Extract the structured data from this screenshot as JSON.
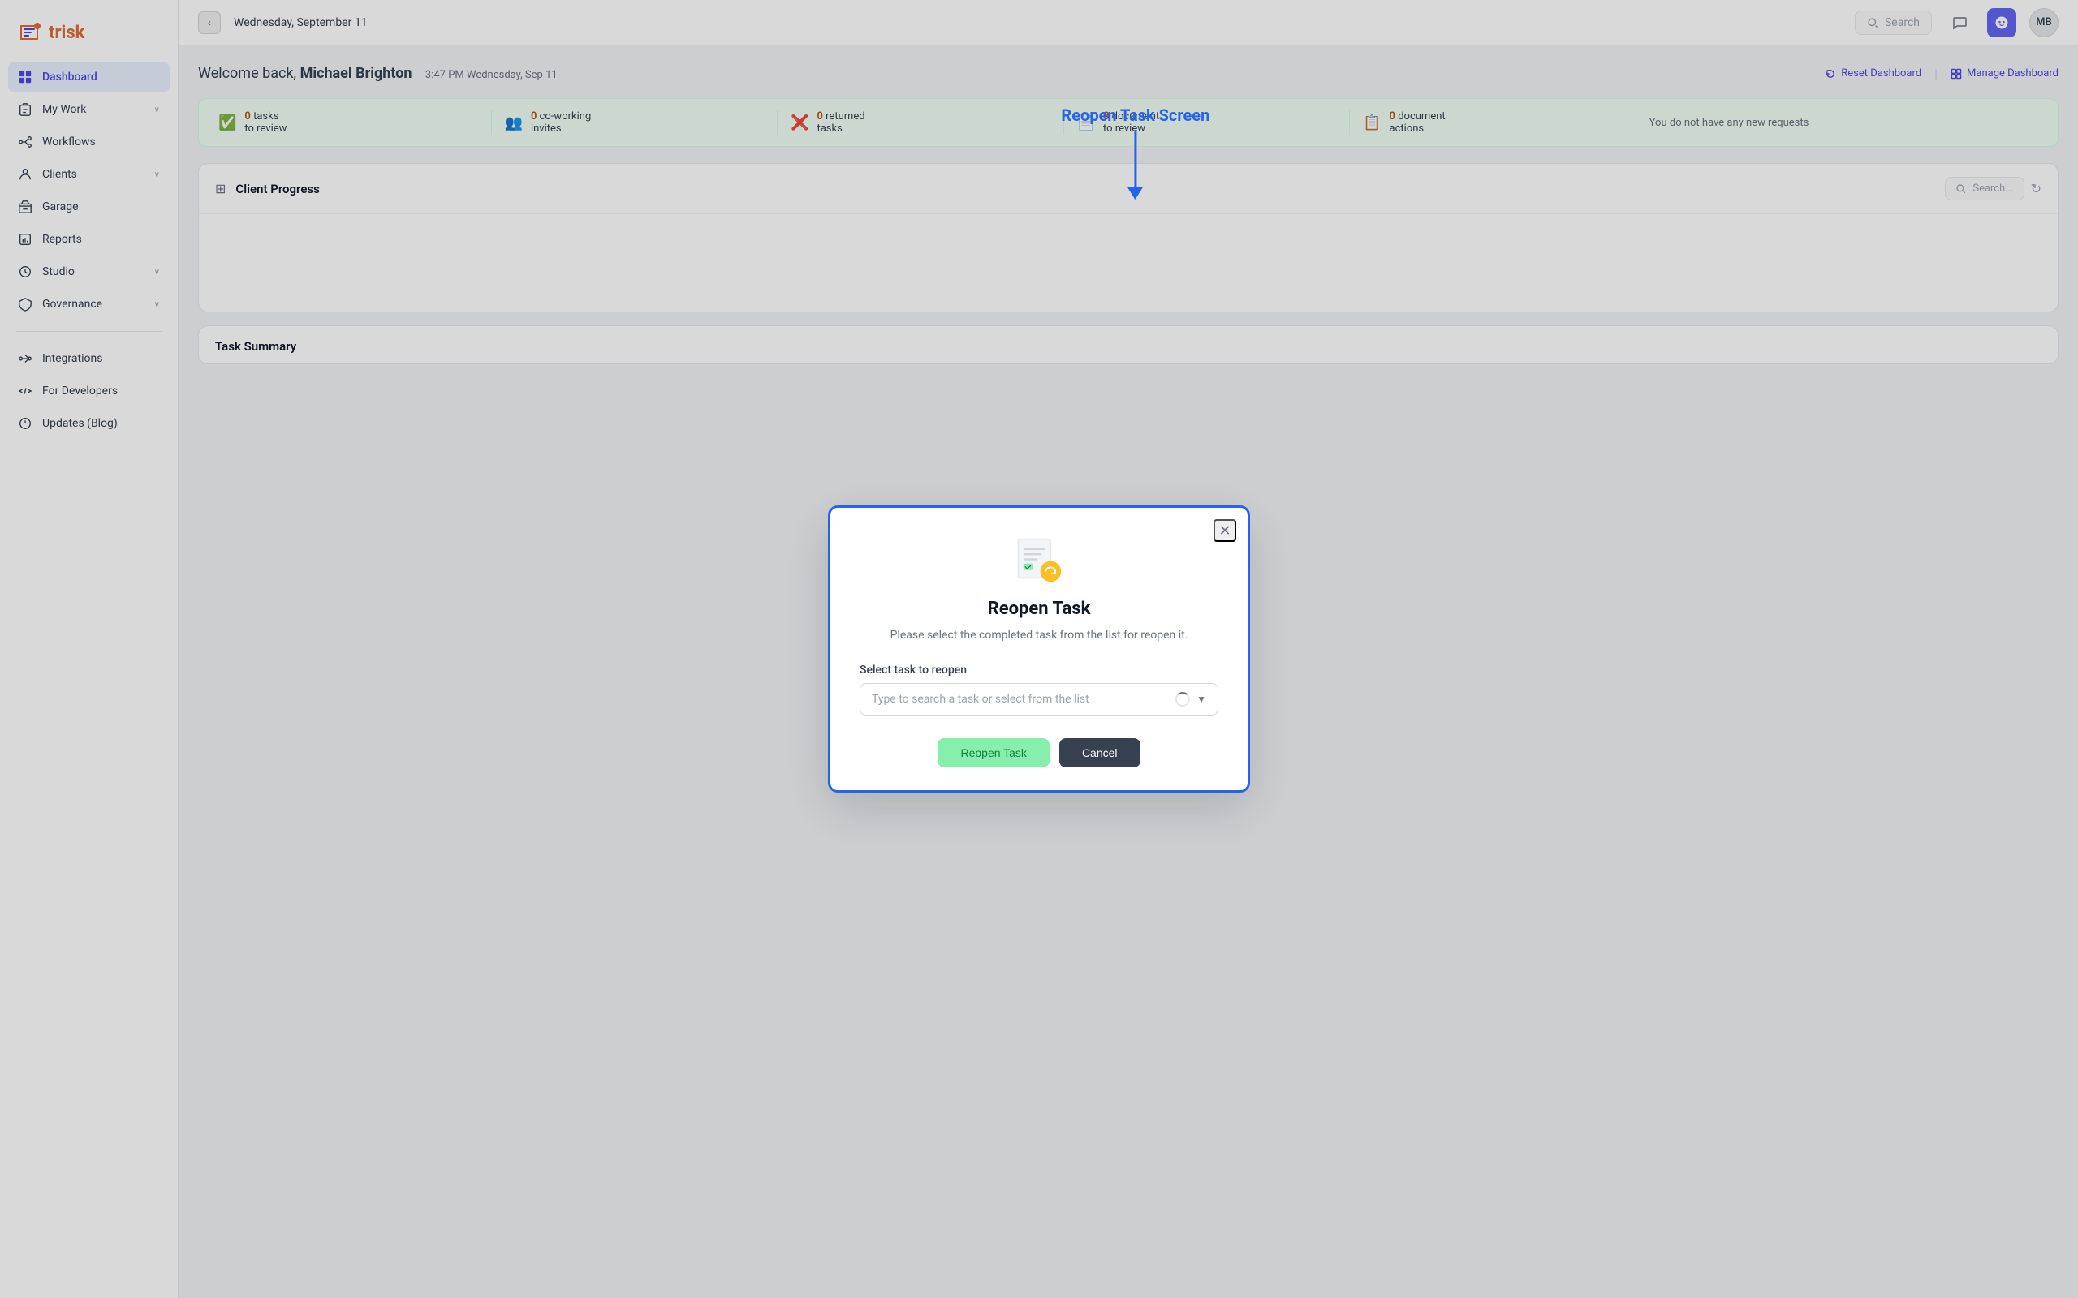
{
  "app": {
    "name": "trisk",
    "logo_icon": "🔷"
  },
  "topbar": {
    "date": "Wednesday, September 11",
    "search_placeholder": "Search",
    "user_initials": "MB",
    "back_icon": "‹"
  },
  "sidebar": {
    "items": [
      {
        "id": "dashboard",
        "label": "Dashboard",
        "icon": "dashboard",
        "active": true,
        "has_chevron": false
      },
      {
        "id": "my-work",
        "label": "My Work",
        "icon": "my-work",
        "active": false,
        "has_chevron": true
      },
      {
        "id": "workflows",
        "label": "Workflows",
        "icon": "workflows",
        "active": false,
        "has_chevron": false
      },
      {
        "id": "clients",
        "label": "Clients",
        "icon": "clients",
        "active": false,
        "has_chevron": true
      },
      {
        "id": "garage",
        "label": "Garage",
        "icon": "garage",
        "active": false,
        "has_chevron": false
      },
      {
        "id": "reports",
        "label": "Reports",
        "icon": "reports",
        "active": false,
        "has_chevron": false
      },
      {
        "id": "studio",
        "label": "Studio",
        "icon": "studio",
        "active": false,
        "has_chevron": true
      },
      {
        "id": "governance",
        "label": "Governance",
        "icon": "governance",
        "active": false,
        "has_chevron": true
      }
    ],
    "bottom_items": [
      {
        "id": "integrations",
        "label": "Integrations",
        "icon": "integrations"
      },
      {
        "id": "for-developers",
        "label": "For Developers",
        "icon": "for-developers"
      },
      {
        "id": "updates-blog",
        "label": "Updates (Blog)",
        "icon": "updates-blog"
      }
    ]
  },
  "dashboard": {
    "welcome_greeting": "Welcome back, ",
    "user_name": "Michael Brighton",
    "time": "3:47 PM",
    "date_short": "Wednesday, Sep 11",
    "reset_dashboard_label": "Reset Dashboard",
    "manage_dashboard_label": "Manage Dashboard",
    "stats": [
      {
        "num": "0",
        "label": "tasks\nto review",
        "icon": "✅",
        "icon_color": "#f59e0b"
      },
      {
        "num": "0",
        "label": "co-working\ninvites",
        "icon": "👥",
        "icon_color": "#3b82f6"
      },
      {
        "num": "0",
        "label": "returned\ntasks",
        "icon": "❌",
        "icon_color": "#ef4444"
      },
      {
        "num": "0",
        "label": "document\nto review",
        "icon": "📄",
        "icon_color": "#10b981"
      },
      {
        "num": "0",
        "label": "document\nactions",
        "icon": "📋",
        "icon_color": "#10b981"
      }
    ],
    "no_requests_text": "You do not have any new requests",
    "client_progress_title": "Client Progress",
    "search_placeholder": "Search...",
    "task_summary_title": "Task Summary",
    "filter_icon": "▼",
    "refresh_icon": "↻",
    "annotation_label": "Reopen Task Screen"
  },
  "modal": {
    "title": "Reopen Task",
    "description": "Please select the completed task from the list for\nreopen it.",
    "field_label": "Select task to reopen",
    "select_placeholder": "Type to search a task or select from the list",
    "reopen_button_label": "Reopen Task",
    "cancel_button_label": "Cancel",
    "close_icon": "✕"
  }
}
